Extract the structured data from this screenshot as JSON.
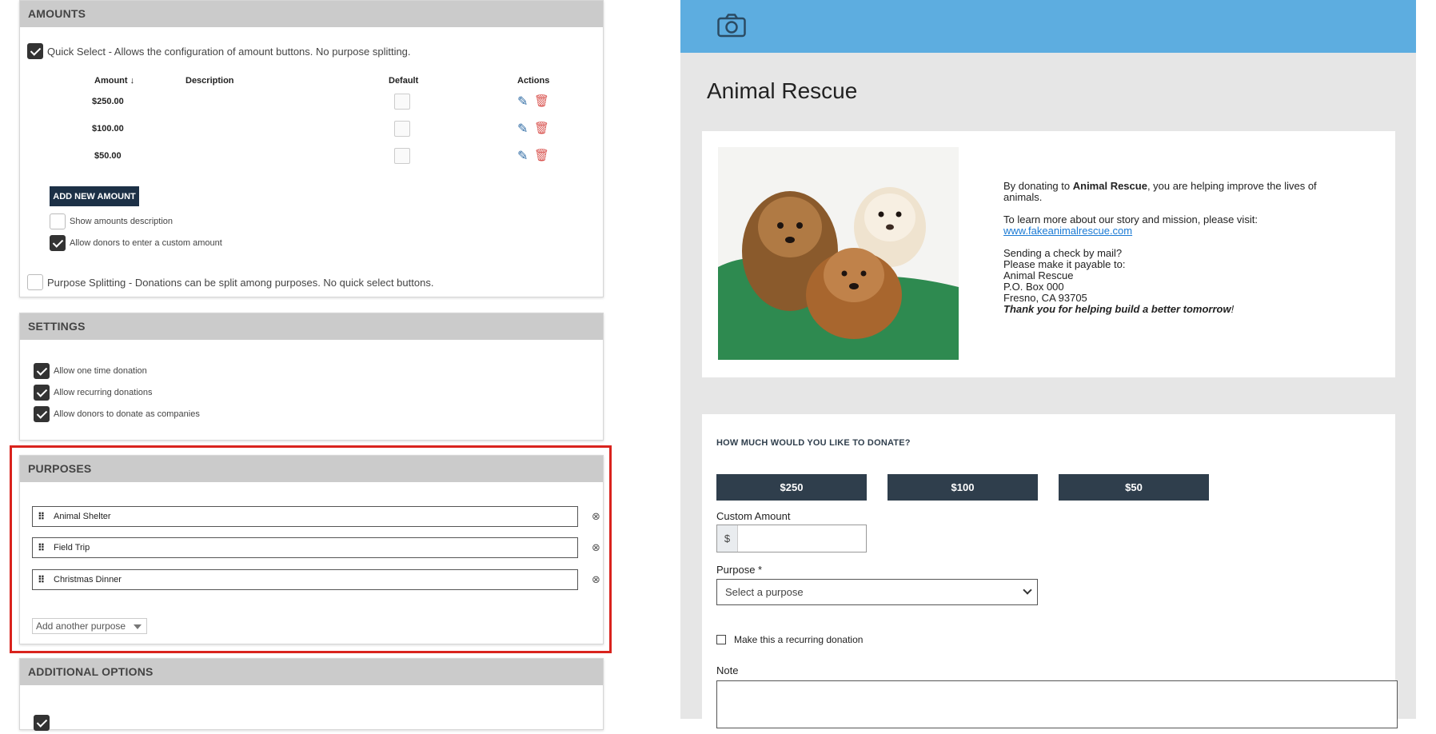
{
  "amounts": {
    "header": "AMOUNTS",
    "quick_select_label": "Quick Select - Allows the configuration of amount buttons. No purpose splitting.",
    "columns": {
      "amount": "Amount ↓",
      "description": "Description",
      "default": "Default",
      "actions": "Actions"
    },
    "rows": [
      {
        "amount": "$250.00"
      },
      {
        "amount": "$100.00"
      },
      {
        "amount": "$50.00"
      }
    ],
    "add_new_label": "ADD NEW AMOUNT",
    "show_description_label": "Show amounts description",
    "allow_custom_label": "Allow donors to enter a custom amount",
    "purpose_splitting_label": "Purpose Splitting - Donations can be split among purposes. No quick select buttons."
  },
  "settings": {
    "header": "SETTINGS",
    "items": [
      {
        "label": "Allow one time donation"
      },
      {
        "label": "Allow recurring donations"
      },
      {
        "label": "Allow donors to donate as companies"
      }
    ]
  },
  "purposes": {
    "header": "PURPOSES",
    "items": [
      {
        "label": "Animal Shelter"
      },
      {
        "label": "Field Trip"
      },
      {
        "label": "Christmas Dinner"
      }
    ],
    "add_another_label": "Add another purpose"
  },
  "additional_options": {
    "header": "ADDITIONAL OPTIONS"
  },
  "preview": {
    "org_title": "Animal Rescue",
    "desc_line1_pre": "By donating to ",
    "desc_line1_bold": "Animal Rescue",
    "desc_line1_post": ", you are helping improve the lives of animals.",
    "learn_more": "To learn more about our story and mission, please visit:",
    "website": "www.fakeanimalrescue.com",
    "check_lines": [
      "Sending a check by mail?",
      "Please make it payable to:",
      "Animal Rescue",
      "P.O. Box 000",
      "Fresno, CA 93705"
    ],
    "thank_you": "Thank you for helping build a better tomorrow",
    "thank_you_end": "!",
    "ask": "HOW MUCH WOULD YOU LIKE TO DONATE?",
    "amount_buttons": [
      "$250",
      "$100",
      "$50"
    ],
    "custom_amount_label": "Custom Amount",
    "currency_prefix": "$",
    "purpose_label": "Purpose *",
    "purpose_placeholder": "Select a purpose",
    "recurring_label": "Make this a recurring donation",
    "note_label": "Note"
  },
  "colors": {
    "header_bar": "#5dade0",
    "dark_button": "#2f3e4c",
    "highlight": "#d9231d",
    "delete_icon": "#d9534f",
    "edit_icon": "#2d6aa3"
  }
}
